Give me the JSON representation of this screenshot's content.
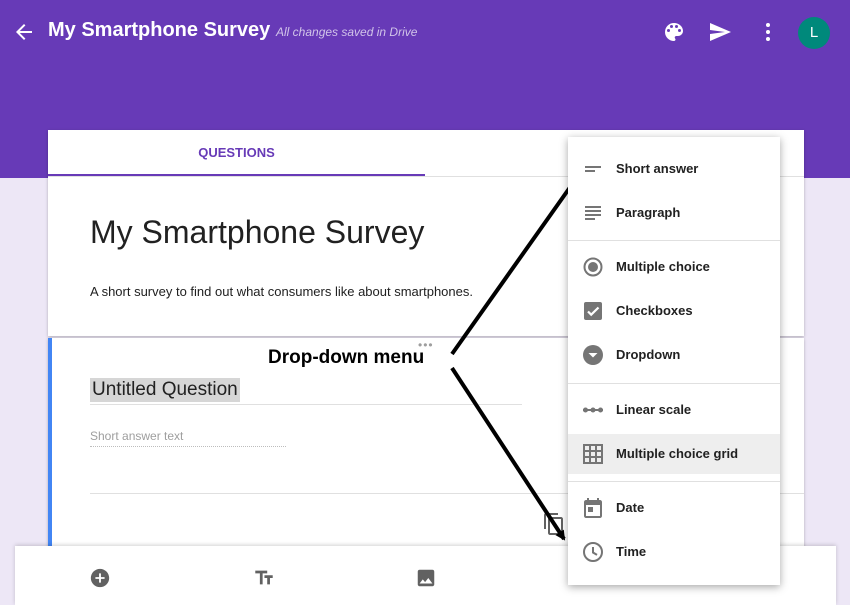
{
  "header": {
    "title": "My Smartphone Survey",
    "save_status": "All changes saved in Drive",
    "avatar_letter": "L",
    "background_color": "#673ab7",
    "icons": [
      "arrow-left-icon",
      "palette-icon",
      "send-icon",
      "more-vert-icon"
    ]
  },
  "tabs": {
    "questions": "QUESTIONS"
  },
  "form": {
    "title": "My Smartphone Survey",
    "description": "A short survey to find out what consumers like about smartphones."
  },
  "question": {
    "title": "Untitled Question",
    "answer_hint": "Short answer text"
  },
  "annotation": {
    "label": "Drop-down menu"
  },
  "menu": {
    "items": [
      {
        "label": "Short answer",
        "icon": "short-text-icon"
      },
      {
        "label": "Paragraph",
        "icon": "paragraph-icon"
      },
      {
        "label": "Multiple choice",
        "icon": "radio-button-icon"
      },
      {
        "label": "Checkboxes",
        "icon": "checkbox-icon"
      },
      {
        "label": "Dropdown",
        "icon": "dropdown-circle-icon"
      },
      {
        "label": "Linear scale",
        "icon": "linear-scale-icon"
      },
      {
        "label": "Multiple choice grid",
        "icon": "grid-icon",
        "selected": true
      },
      {
        "label": "Date",
        "icon": "calendar-icon"
      },
      {
        "label": "Time",
        "icon": "clock-icon"
      }
    ]
  },
  "toolbar": {
    "icons": [
      "add-circle-icon",
      "text-format-icon",
      "image-icon"
    ]
  },
  "colors": {
    "accent": "#673ab7",
    "question_border": "#4285f4",
    "avatar": "#00897b"
  }
}
